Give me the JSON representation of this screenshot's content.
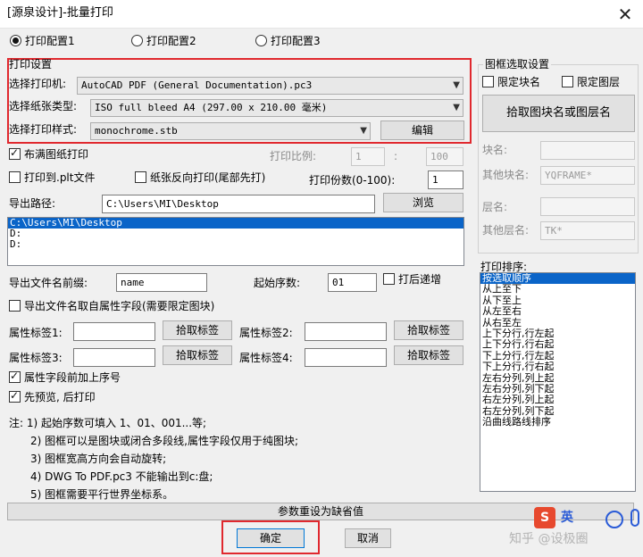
{
  "window": {
    "title": "[源泉设计]-批量打印"
  },
  "tabs": [
    {
      "label": "打印配置1",
      "selected": true
    },
    {
      "label": "打印配置2",
      "selected": false
    },
    {
      "label": "打印配置3",
      "selected": false
    }
  ],
  "print_settings": {
    "group_label": "打印设置",
    "printer_label": "选择打印机:",
    "printer_value": "AutoCAD PDF (General Documentation).pc3",
    "paper_label": "选择纸张类型:",
    "paper_value": "ISO full bleed A4 (297.00 x 210.00 毫米)",
    "style_label": "选择打印样式:",
    "style_value": "monochrome.stb",
    "edit_button": "编辑"
  },
  "options": {
    "fill_paper": {
      "label": "布满图纸打印",
      "checked": true
    },
    "scale_label": "打印比例:",
    "scale_left": "1",
    "scale_sep": ":",
    "scale_right": "100",
    "plot_to_plt": {
      "label": "打印到.plt文件",
      "checked": false
    },
    "reverse_paper": {
      "label": "纸张反向打印(尾部先打)",
      "checked": false
    },
    "copies_label": "打印份数(0-100):",
    "copies_value": "1"
  },
  "export": {
    "path_label": "导出路径:",
    "path_value": "C:\\Users\\MI\\Desktop",
    "browse_button": "浏览",
    "path_list": [
      "C:\\Users\\MI\\Desktop",
      "D:",
      "D:"
    ],
    "prefix_label": "导出文件名前缀:",
    "prefix_value": "name",
    "start_label": "起始序数:",
    "start_value": "01",
    "increment_after": {
      "label": "打后递增",
      "checked": false
    },
    "name_from_attr": {
      "label": "导出文件名取自属性字段(需要限定图块)",
      "checked": false
    }
  },
  "attributes": {
    "tag1_label": "属性标签1:",
    "tag2_label": "属性标签2:",
    "tag3_label": "属性标签3:",
    "tag4_label": "属性标签4:",
    "pick_button": "拾取标签",
    "prepend_seq": {
      "label": "属性字段前加上序号",
      "checked": true
    },
    "preview_first": {
      "label": "先预览, 后打印",
      "checked": true
    }
  },
  "notes": [
    "注: 1) 起始序数可填入 1、01、001...等;",
    "2) 图框可以是图块或闭合多段线,属性字段仅用于纯图块;",
    "3) 图框宽高方向会自动旋转;",
    "4) DWG To PDF.pc3 不能输出到c:盘;",
    "5) 图框需要平行世界坐标系。"
  ],
  "frame_select": {
    "group_label": "图框选取设置",
    "limit_block": {
      "label": "限定块名",
      "checked": false
    },
    "limit_layer": {
      "label": "限定图层",
      "checked": false
    },
    "pick_button": "拾取图块名或图层名",
    "block_name_label": "块名:",
    "block_name_value": "",
    "other_block_label": "其他块名:",
    "other_block_value": "YQFRAME*",
    "layer_label": "层名:",
    "layer_value": "",
    "other_layer_label": "其他层名:",
    "other_layer_value": "TK*"
  },
  "print_order": {
    "label": "打印排序:",
    "items": [
      "按选取顺序",
      "从上至下",
      "从下至上",
      "从左至右",
      "从右至左",
      "上下分行,行左起",
      "上下分行,行右起",
      "下上分行,行左起",
      "下上分行,行右起",
      "左右分列,列上起",
      "左右分列,列下起",
      "右左分列,列上起",
      "右左分列,列下起",
      "沿曲线路线排序"
    ],
    "selected_index": 0
  },
  "footer": {
    "reset_button": "参数重设为缺省值",
    "ok_button": "确定",
    "cancel_button": "取消"
  },
  "watermark": {
    "text": "知乎 @设极圈",
    "badge": "英"
  }
}
